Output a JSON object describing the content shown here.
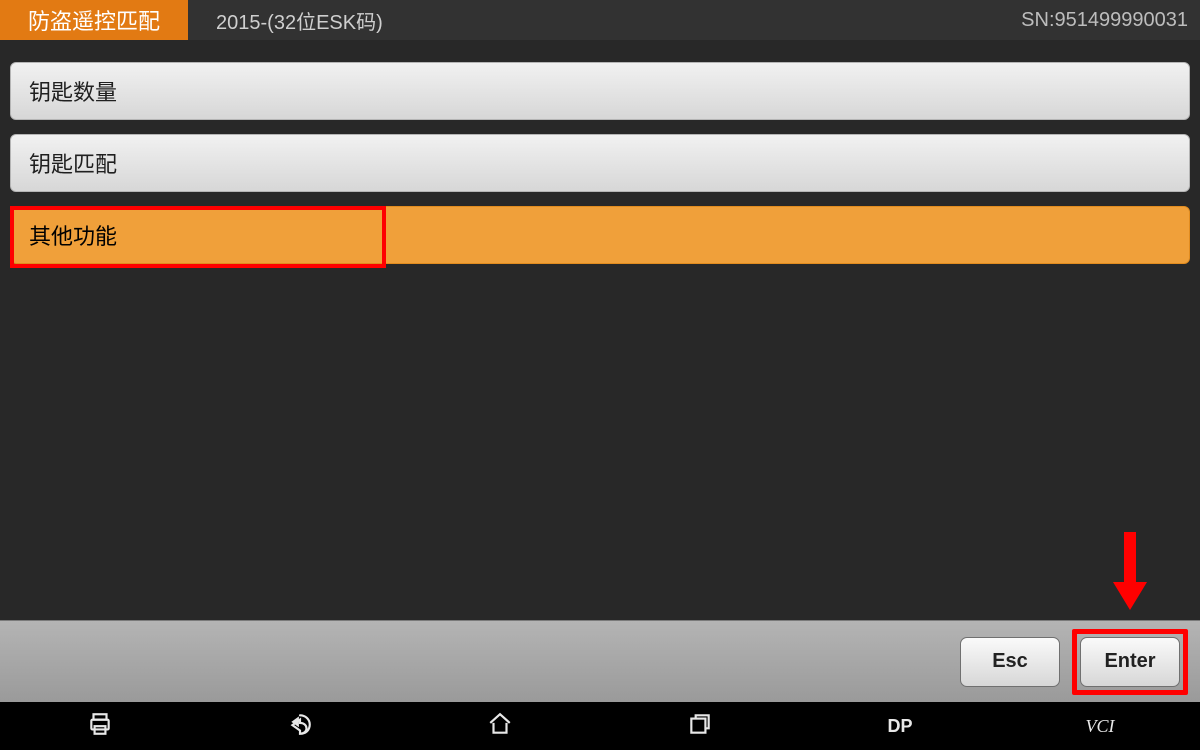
{
  "topbar": {
    "tab_label": "防盗遥控匹配",
    "title": "2015-(32位ESK码)",
    "sn": "SN:951499990031"
  },
  "menu": {
    "items": [
      {
        "label": "钥匙数量",
        "selected": false
      },
      {
        "label": "钥匙匹配",
        "selected": false
      },
      {
        "label": "其他功能",
        "selected": true
      }
    ]
  },
  "buttons": {
    "esc": "Esc",
    "enter": "Enter"
  },
  "nav": {
    "dp": "DP",
    "vci": "VCI"
  },
  "annotations": {
    "highlight_menu_index": 2,
    "arrow_target": "enter-button"
  },
  "colors": {
    "accent": "#e27a13",
    "selected": "#f0a03a",
    "highlight": "#ff0000"
  }
}
